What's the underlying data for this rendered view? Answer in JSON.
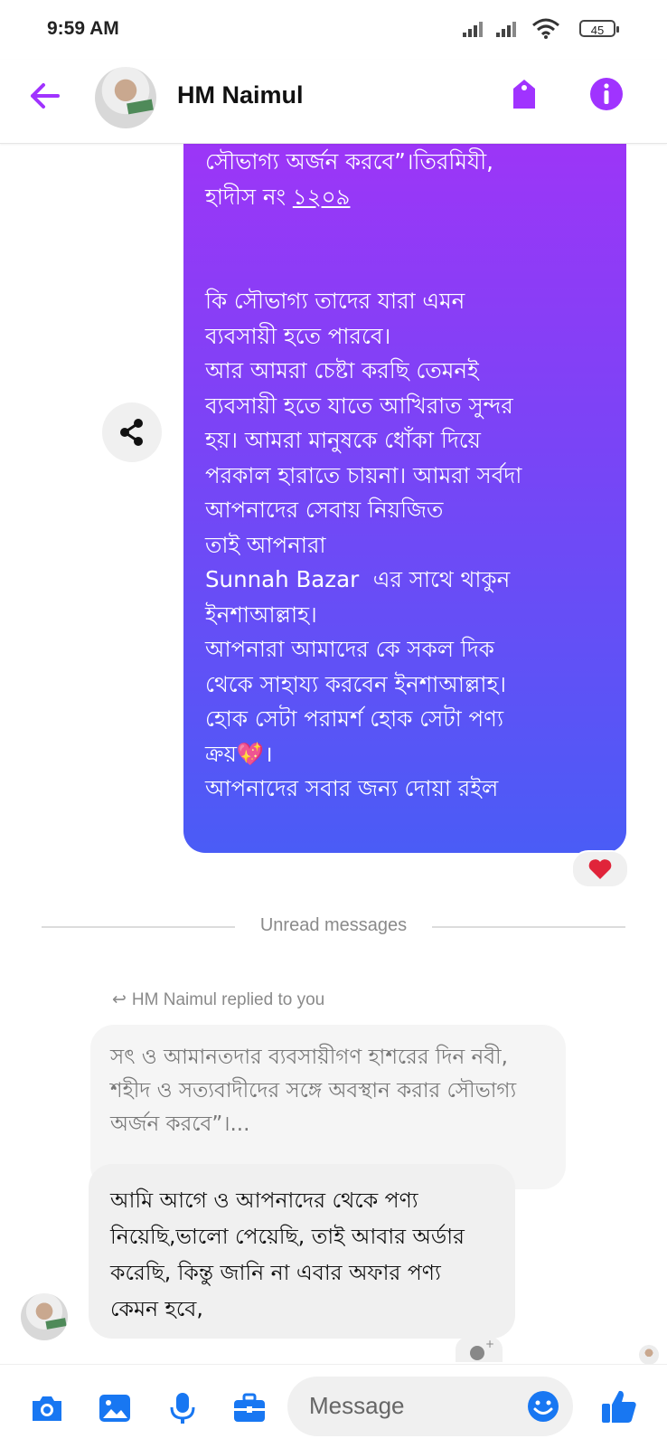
{
  "status_bar": {
    "time": "9:59 AM",
    "battery": "45"
  },
  "header": {
    "contact_name": "HM Naimul"
  },
  "colors": {
    "accent": "#a033ff",
    "bubble_top": "#a034f7",
    "bubble_bottom": "#4a5cf6",
    "heart": "#e0243a"
  },
  "conversation": {
    "sent_message": {
      "lines": [
        "সৌভাগ্য অর্জন করবে”।তিরমিযী,",
        "হাদীস নং ",
        "১২০৯",
        "",
        "",
        "কি সৌভাগ্য তাদের যারা এমন",
        "ব্যবসায়ী হতে পারবে।",
        "আর আমরা চেষ্টা করছি তেমনই",
        "ব্যবসায়ী হতে যাতে আখিরাত সুন্দর",
        "হয়। আমরা মানুষকে ধোঁকা দিয়ে",
        "পরকাল হারাতে চায়না। আমরা সর্বদা",
        "আপনাদের সেবায় নিয়জিত",
        "তাই আপনারা",
        "Sunnah Bazar  এর সাথে থাকুন",
        "ইনশাআল্লাহ।",
        "আপনারা আমাদের কে সকল দিক",
        "থেকে সাহায্য করবেন ইনশাআল্লাহ।",
        "হোক সেটা পরামর্শ হোক সেটা পণ্য",
        "ক্রয়💖।",
        "আপনাদের সবার জন্য দোয়া রইল"
      ],
      "reaction": "❤️"
    },
    "unread_label": "Unread messages",
    "reply_info": "HM Naimul replied to you",
    "quoted_text": "সৎ ও আমানতদার ব্যবসায়ীগণ হাশরের দিন নবী, শহীদ ও সত্যবাদীদের সঙ্গে অবস্থান করার সৌভাগ্য অর্জন করবে”।...",
    "received_message": "আমি আগে ও আপনাদের থেকে পণ্য নিয়েছি,ভালো পেয়েছি, তাই আবার অর্ডার করেছি, কিন্তু জানি না এবার অফার পণ্য কেমন হবে,"
  },
  "composer": {
    "placeholder": "Message"
  }
}
